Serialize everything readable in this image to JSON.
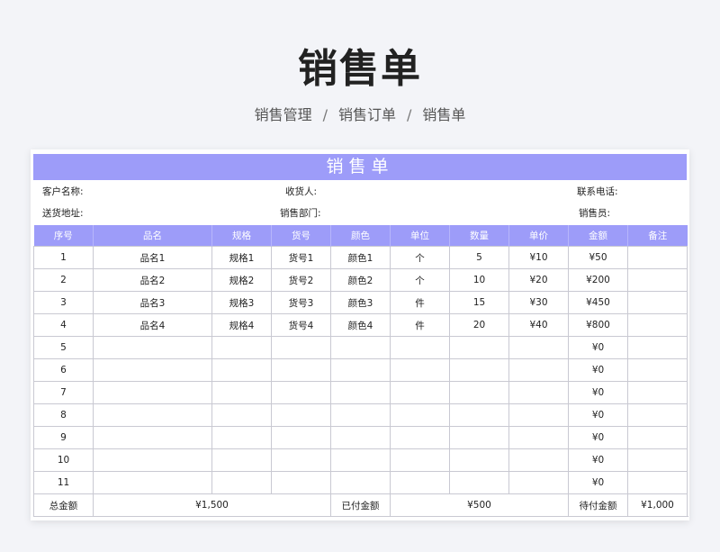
{
  "page_title": "销售单",
  "breadcrumb": [
    "销售管理",
    "销售订单",
    "销售单"
  ],
  "breadcrumb_separator": "/",
  "colors": {
    "header_bg": "#9d9cf9",
    "page_bg": "#f3f4f8"
  },
  "sheet": {
    "title": "销售单",
    "info": {
      "customer_name": "客户名称:",
      "receiver": "收货人:",
      "contact_phone": "联系电话:",
      "delivery_address": "送货地址:",
      "sales_dept": "销售部门:",
      "salesperson": "销售员:"
    },
    "columns": [
      "序号",
      "品名",
      "规格",
      "货号",
      "颜色",
      "单位",
      "数量",
      "单价",
      "金额",
      "备注"
    ],
    "rows": [
      [
        "1",
        "品名1",
        "规格1",
        "货号1",
        "颜色1",
        "个",
        "5",
        "¥10",
        "¥50",
        ""
      ],
      [
        "2",
        "品名2",
        "规格2",
        "货号2",
        "颜色2",
        "个",
        "10",
        "¥20",
        "¥200",
        ""
      ],
      [
        "3",
        "品名3",
        "规格3",
        "货号3",
        "颜色3",
        "件",
        "15",
        "¥30",
        "¥450",
        ""
      ],
      [
        "4",
        "品名4",
        "规格4",
        "货号4",
        "颜色4",
        "件",
        "20",
        "¥40",
        "¥800",
        ""
      ],
      [
        "5",
        "",
        "",
        "",
        "",
        "",
        "",
        "",
        "¥0",
        ""
      ],
      [
        "6",
        "",
        "",
        "",
        "",
        "",
        "",
        "",
        "¥0",
        ""
      ],
      [
        "7",
        "",
        "",
        "",
        "",
        "",
        "",
        "",
        "¥0",
        ""
      ],
      [
        "8",
        "",
        "",
        "",
        "",
        "",
        "",
        "",
        "¥0",
        ""
      ],
      [
        "9",
        "",
        "",
        "",
        "",
        "",
        "",
        "",
        "¥0",
        ""
      ],
      [
        "10",
        "",
        "",
        "",
        "",
        "",
        "",
        "",
        "¥0",
        ""
      ],
      [
        "11",
        "",
        "",
        "",
        "",
        "",
        "",
        "",
        "¥0",
        ""
      ]
    ],
    "totals": {
      "total_label": "总金额",
      "total_value": "¥1,500",
      "paid_label": "已付金额",
      "paid_value": "¥500",
      "due_label": "待付金额",
      "due_value": "¥1,000"
    }
  }
}
